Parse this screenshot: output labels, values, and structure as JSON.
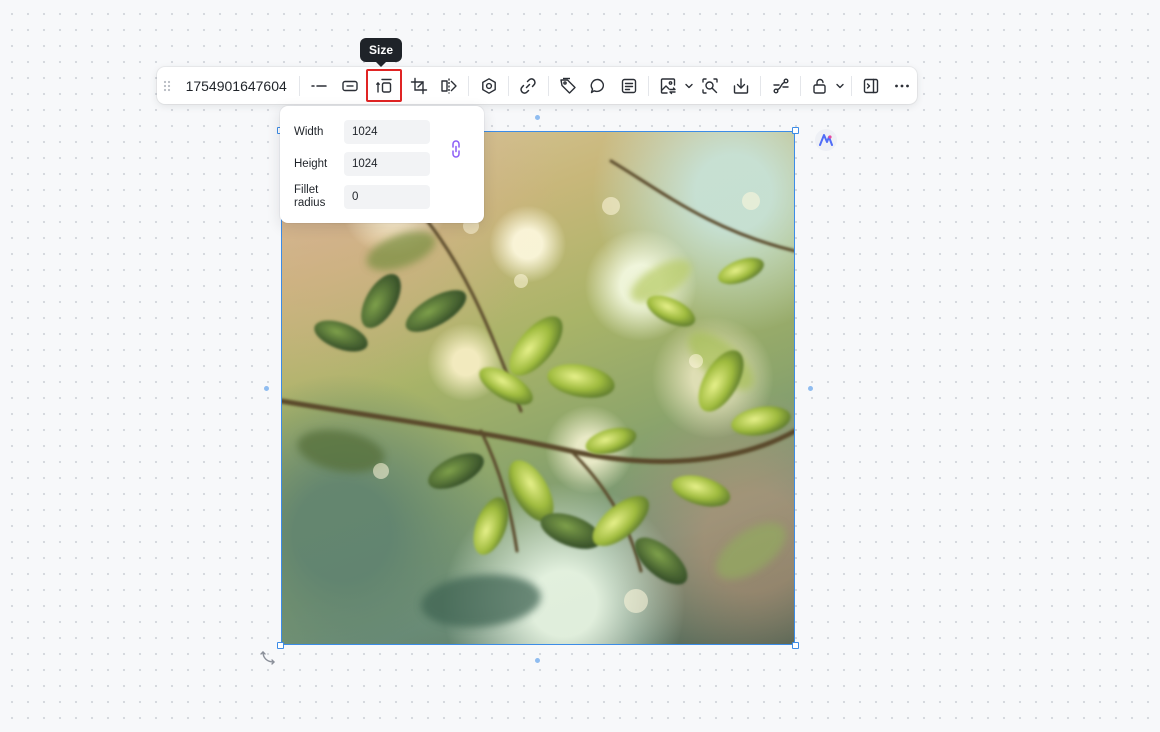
{
  "toolbar": {
    "name_label": "1754901647604",
    "buttons": [
      {
        "name": "line-style-icon",
        "active": false
      },
      {
        "name": "border-icon",
        "active": false
      },
      {
        "name": "size-icon",
        "active": true
      },
      {
        "name": "crop-icon",
        "active": false
      },
      {
        "name": "flip-icon",
        "active": false
      },
      {
        "name": "settings-icon",
        "active": false
      },
      {
        "name": "link-icon",
        "active": false
      },
      {
        "name": "tag-icon",
        "active": false
      },
      {
        "name": "comment-icon",
        "active": false
      },
      {
        "name": "note-icon",
        "active": false
      },
      {
        "name": "image-replace-icon",
        "active": false,
        "has_caret": true
      },
      {
        "name": "zoom-search-icon",
        "active": false
      },
      {
        "name": "download-icon",
        "active": false
      },
      {
        "name": "connector-icon",
        "active": false
      },
      {
        "name": "lock-icon",
        "active": false,
        "has_caret": true
      },
      {
        "name": "present-icon",
        "active": false
      },
      {
        "name": "more-icon",
        "active": false
      }
    ]
  },
  "tooltip": {
    "text": "Size"
  },
  "size_panel": {
    "width_label": "Width",
    "width_value": "1024",
    "height_label": "Height",
    "height_value": "1024",
    "radius_label": "Fillet radius",
    "radius_value": "0",
    "lock_icon": "aspect-lock-icon"
  },
  "canvas": {
    "selection_color": "#3c8ce7",
    "image_subject": "sunlit green leaves with bokeh background"
  },
  "colors": {
    "accent": "#3c8ce7",
    "active_outline": "#e02424",
    "lock_icon": "#8b5cf6",
    "tooltip_bg": "#1f2329"
  }
}
